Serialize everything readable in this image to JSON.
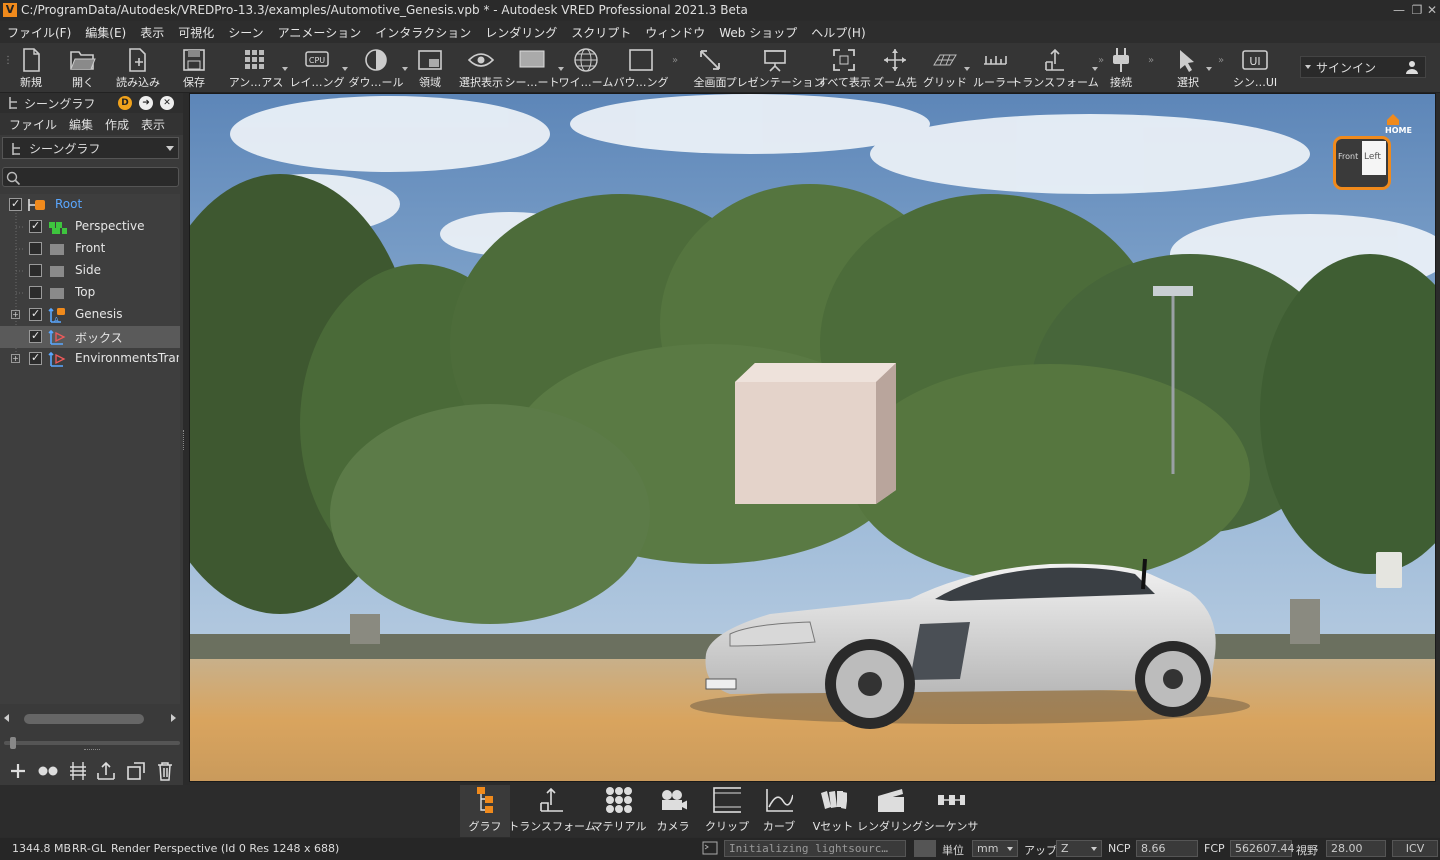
{
  "window": {
    "title": "C:/ProgramData/Autodesk/VREDPro-13.3/examples/Automotive_Genesis.vpb * - Autodesk VRED Professional 2021.3 Beta",
    "app_icon": "V"
  },
  "menubar": [
    "ファイル(F)",
    "編集(E)",
    "表示",
    "可視化",
    "シーン",
    "アニメーション",
    "インタラクション",
    "レンダリング",
    "スクリプト",
    "ウィンドウ",
    "Web ショップ",
    "ヘルプ(H)"
  ],
  "toolbar": {
    "items": [
      {
        "label": "新規",
        "icon": "new-file-icon"
      },
      {
        "label": "開く",
        "icon": "open-folder-icon"
      },
      {
        "label": "読み込み",
        "icon": "import-icon"
      },
      {
        "label": "保存",
        "icon": "save-icon"
      },
      {
        "label": "アン…アス",
        "icon": "antialias-icon"
      },
      {
        "label": "レイ…ング",
        "icon": "raytracing-cpu-icon"
      },
      {
        "label": "ダウ…ール",
        "icon": "downscale-icon"
      },
      {
        "label": "領域",
        "icon": "region-icon"
      },
      {
        "label": "選択表示",
        "icon": "eye-icon"
      },
      {
        "label": "シー…ート",
        "icon": "scene-icon"
      },
      {
        "label": "ワイ…ーム",
        "icon": "wireframe-globe-icon"
      },
      {
        "label": "バウ…ング",
        "icon": "bounding-box-icon"
      },
      {
        "label": "全画面",
        "icon": "fullscreen-icon"
      },
      {
        "label": "プレゼンテーション",
        "icon": "presentation-icon"
      },
      {
        "label": "すべて表示",
        "icon": "show-all-icon"
      },
      {
        "label": "ズーム先",
        "icon": "zoom-to-icon"
      },
      {
        "label": "グリッド",
        "icon": "grid-icon"
      },
      {
        "label": "ルーラー",
        "icon": "ruler-icon"
      },
      {
        "label": "トランスフォーム",
        "icon": "transform-icon"
      },
      {
        "label": "接続",
        "icon": "plug-icon"
      },
      {
        "label": "選択",
        "icon": "select-icon"
      },
      {
        "label": "シン…UI",
        "icon": "simple-ui-icon"
      }
    ],
    "signin": "サインイン",
    "ui_icon_text": "UI",
    "cpu_text": "CPU"
  },
  "scenegraph": {
    "title": "シーングラフ",
    "badge_d": "D",
    "menu": [
      "ファイル",
      "編集",
      "作成",
      "表示"
    ],
    "select_value": "シーングラフ",
    "nodes": [
      {
        "label": "Root",
        "checked": true
      },
      {
        "label": "Perspective",
        "checked": true
      },
      {
        "label": "Front",
        "checked": false
      },
      {
        "label": "Side",
        "checked": false
      },
      {
        "label": "Top",
        "checked": false
      },
      {
        "label": "Genesis",
        "checked": true
      },
      {
        "label": "ボックス",
        "checked": true
      },
      {
        "label": "EnvironmentsTransf",
        "checked": true
      }
    ],
    "selected_node": "ボックス"
  },
  "viewcube": {
    "home_label": "HOME",
    "face_left": "Left",
    "face_front": "Front"
  },
  "modules": [
    {
      "label": "グラフ",
      "icon": "graph-icon",
      "active": true
    },
    {
      "label": "トランスフォーム",
      "icon": "transform-module-icon",
      "active": false
    },
    {
      "label": "マテリアル",
      "icon": "material-icon",
      "active": false
    },
    {
      "label": "カメラ",
      "icon": "camera-icon",
      "active": false
    },
    {
      "label": "クリップ",
      "icon": "clip-icon",
      "active": false
    },
    {
      "label": "カーブ",
      "icon": "curve-icon",
      "active": false
    },
    {
      "label": "Vセット",
      "icon": "vset-icon",
      "active": false
    },
    {
      "label": "レンダリング",
      "icon": "render-clapper-icon",
      "active": false
    },
    {
      "label": "シーケンサ",
      "icon": "sequencer-icon",
      "active": false
    }
  ],
  "status": {
    "memory": "1344.8 MB",
    "renderer": "RR-GL",
    "render_info": "Render Perspective (Id 0 Res 1248 x 688)",
    "log_text": "Initializing lightsourc…",
    "unit_label": "単位",
    "unit_value": "mm",
    "up_label": "アップ",
    "up_value": "Z",
    "ncp_label": "NCP",
    "ncp_value": "8.66",
    "fcp_label": "FCP",
    "fcp_value": "562607.44",
    "fov_label": "視野",
    "fov_value": "28.00",
    "icv": "ICV"
  },
  "colors": {
    "accent": "#f08a1c",
    "root_text": "#5aa7ff",
    "selected_row": "#5a5a5a"
  }
}
